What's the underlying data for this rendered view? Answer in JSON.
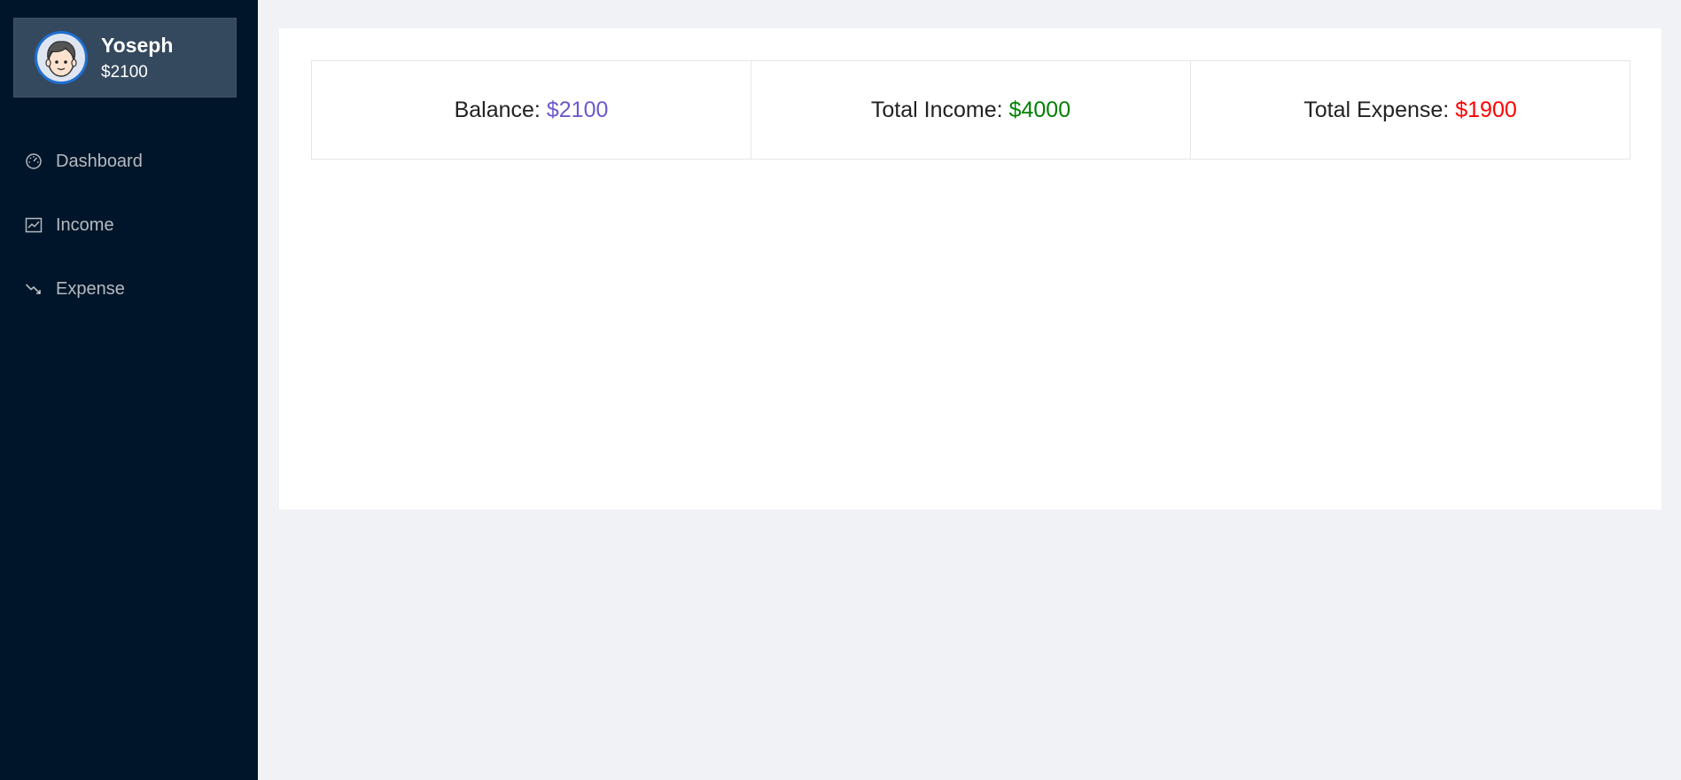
{
  "sidebar": {
    "profile": {
      "name": "Yoseph",
      "balance": "$2100",
      "avatar_icon": "avatar-face-icon"
    },
    "items": [
      {
        "label": "Dashboard",
        "icon": "dashboard-icon"
      },
      {
        "label": "Income",
        "icon": "line-chart-icon"
      },
      {
        "label": "Expense",
        "icon": "trending-down-icon"
      }
    ]
  },
  "stats": {
    "balance": {
      "label": "Balance:",
      "value": "$2100",
      "color": "#6a5acd"
    },
    "income": {
      "label": "Total Income:",
      "value": "$4000",
      "color": "#008000"
    },
    "expense": {
      "label": "Total Expense:",
      "value": "$1900",
      "color": "#ff0000"
    }
  },
  "colors": {
    "sidebar_bg": "#001529",
    "profile_bg": "#34495e",
    "page_bg": "#f0f2f5"
  }
}
